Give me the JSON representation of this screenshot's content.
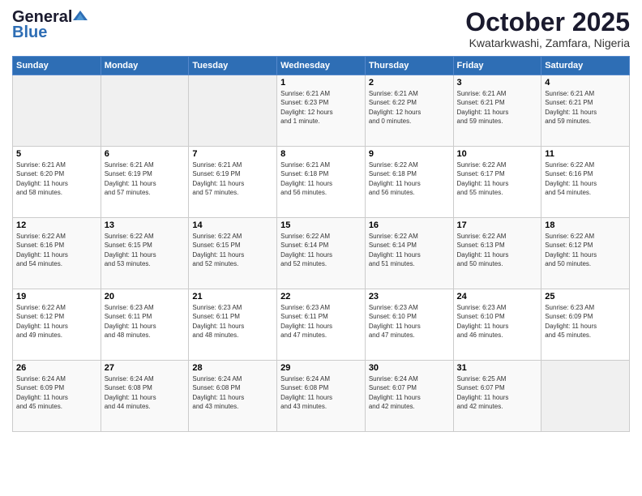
{
  "header": {
    "logo_general": "General",
    "logo_blue": "Blue",
    "title": "October 2025",
    "subtitle": "Kwatarkwashi, Zamfara, Nigeria"
  },
  "days_of_week": [
    "Sunday",
    "Monday",
    "Tuesday",
    "Wednesday",
    "Thursday",
    "Friday",
    "Saturday"
  ],
  "weeks": [
    [
      {
        "day": "",
        "info": ""
      },
      {
        "day": "",
        "info": ""
      },
      {
        "day": "",
        "info": ""
      },
      {
        "day": "1",
        "info": "Sunrise: 6:21 AM\nSunset: 6:23 PM\nDaylight: 12 hours\nand 1 minute."
      },
      {
        "day": "2",
        "info": "Sunrise: 6:21 AM\nSunset: 6:22 PM\nDaylight: 12 hours\nand 0 minutes."
      },
      {
        "day": "3",
        "info": "Sunrise: 6:21 AM\nSunset: 6:21 PM\nDaylight: 11 hours\nand 59 minutes."
      },
      {
        "day": "4",
        "info": "Sunrise: 6:21 AM\nSunset: 6:21 PM\nDaylight: 11 hours\nand 59 minutes."
      }
    ],
    [
      {
        "day": "5",
        "info": "Sunrise: 6:21 AM\nSunset: 6:20 PM\nDaylight: 11 hours\nand 58 minutes."
      },
      {
        "day": "6",
        "info": "Sunrise: 6:21 AM\nSunset: 6:19 PM\nDaylight: 11 hours\nand 57 minutes."
      },
      {
        "day": "7",
        "info": "Sunrise: 6:21 AM\nSunset: 6:19 PM\nDaylight: 11 hours\nand 57 minutes."
      },
      {
        "day": "8",
        "info": "Sunrise: 6:21 AM\nSunset: 6:18 PM\nDaylight: 11 hours\nand 56 minutes."
      },
      {
        "day": "9",
        "info": "Sunrise: 6:22 AM\nSunset: 6:18 PM\nDaylight: 11 hours\nand 56 minutes."
      },
      {
        "day": "10",
        "info": "Sunrise: 6:22 AM\nSunset: 6:17 PM\nDaylight: 11 hours\nand 55 minutes."
      },
      {
        "day": "11",
        "info": "Sunrise: 6:22 AM\nSunset: 6:16 PM\nDaylight: 11 hours\nand 54 minutes."
      }
    ],
    [
      {
        "day": "12",
        "info": "Sunrise: 6:22 AM\nSunset: 6:16 PM\nDaylight: 11 hours\nand 54 minutes."
      },
      {
        "day": "13",
        "info": "Sunrise: 6:22 AM\nSunset: 6:15 PM\nDaylight: 11 hours\nand 53 minutes."
      },
      {
        "day": "14",
        "info": "Sunrise: 6:22 AM\nSunset: 6:15 PM\nDaylight: 11 hours\nand 52 minutes."
      },
      {
        "day": "15",
        "info": "Sunrise: 6:22 AM\nSunset: 6:14 PM\nDaylight: 11 hours\nand 52 minutes."
      },
      {
        "day": "16",
        "info": "Sunrise: 6:22 AM\nSunset: 6:14 PM\nDaylight: 11 hours\nand 51 minutes."
      },
      {
        "day": "17",
        "info": "Sunrise: 6:22 AM\nSunset: 6:13 PM\nDaylight: 11 hours\nand 50 minutes."
      },
      {
        "day": "18",
        "info": "Sunrise: 6:22 AM\nSunset: 6:12 PM\nDaylight: 11 hours\nand 50 minutes."
      }
    ],
    [
      {
        "day": "19",
        "info": "Sunrise: 6:22 AM\nSunset: 6:12 PM\nDaylight: 11 hours\nand 49 minutes."
      },
      {
        "day": "20",
        "info": "Sunrise: 6:23 AM\nSunset: 6:11 PM\nDaylight: 11 hours\nand 48 minutes."
      },
      {
        "day": "21",
        "info": "Sunrise: 6:23 AM\nSunset: 6:11 PM\nDaylight: 11 hours\nand 48 minutes."
      },
      {
        "day": "22",
        "info": "Sunrise: 6:23 AM\nSunset: 6:11 PM\nDaylight: 11 hours\nand 47 minutes."
      },
      {
        "day": "23",
        "info": "Sunrise: 6:23 AM\nSunset: 6:10 PM\nDaylight: 11 hours\nand 47 minutes."
      },
      {
        "day": "24",
        "info": "Sunrise: 6:23 AM\nSunset: 6:10 PM\nDaylight: 11 hours\nand 46 minutes."
      },
      {
        "day": "25",
        "info": "Sunrise: 6:23 AM\nSunset: 6:09 PM\nDaylight: 11 hours\nand 45 minutes."
      }
    ],
    [
      {
        "day": "26",
        "info": "Sunrise: 6:24 AM\nSunset: 6:09 PM\nDaylight: 11 hours\nand 45 minutes."
      },
      {
        "day": "27",
        "info": "Sunrise: 6:24 AM\nSunset: 6:08 PM\nDaylight: 11 hours\nand 44 minutes."
      },
      {
        "day": "28",
        "info": "Sunrise: 6:24 AM\nSunset: 6:08 PM\nDaylight: 11 hours\nand 43 minutes."
      },
      {
        "day": "29",
        "info": "Sunrise: 6:24 AM\nSunset: 6:08 PM\nDaylight: 11 hours\nand 43 minutes."
      },
      {
        "day": "30",
        "info": "Sunrise: 6:24 AM\nSunset: 6:07 PM\nDaylight: 11 hours\nand 42 minutes."
      },
      {
        "day": "31",
        "info": "Sunrise: 6:25 AM\nSunset: 6:07 PM\nDaylight: 11 hours\nand 42 minutes."
      },
      {
        "day": "",
        "info": ""
      }
    ]
  ]
}
